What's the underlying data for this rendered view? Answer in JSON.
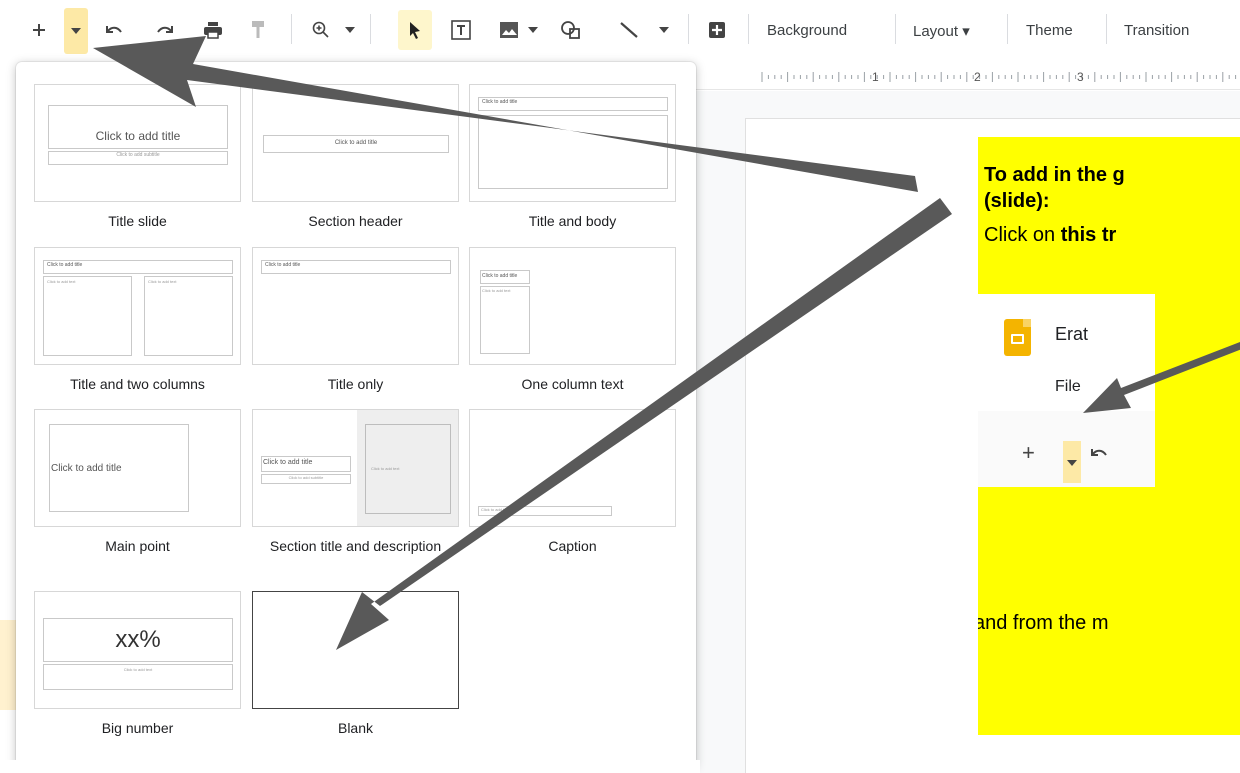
{
  "toolbar": {
    "icons": [
      "plus-icon",
      "chevron-down-icon",
      "undo-icon",
      "redo-icon",
      "print-icon",
      "paint-format-icon",
      "zoom-icon",
      "select-cursor-icon",
      "text-box-icon",
      "image-icon",
      "shape-icon",
      "line-icon",
      "comment-icon"
    ],
    "background_label": "Background",
    "layout_label": "Layout ▾",
    "theme_label": "Theme",
    "transition_label": "Transition"
  },
  "ruler": {
    "marks": [
      "1",
      "2",
      "3"
    ]
  },
  "layouts": [
    {
      "label": "Title slide",
      "title_text": "Click to add title",
      "subtitle_text": "Click to add subtitle"
    },
    {
      "label": "Section header",
      "title_text": "Click to add title"
    },
    {
      "label": "Title and body",
      "title_text": "Click to add title"
    },
    {
      "label": "Title and two columns",
      "title_text": "Click to add title",
      "col1_text": "Click to add text",
      "col2_text": "Click to add text"
    },
    {
      "label": "Title only",
      "title_text": "Click to add title"
    },
    {
      "label": "One column text",
      "title_text": "Click to add title",
      "body_text": "Click to add text"
    },
    {
      "label": "Main point",
      "title_text": "Click to add title"
    },
    {
      "label": "Section title and description",
      "title_text": "Click to add title",
      "subtitle_text": "Click to add subtitle",
      "side_text": "Click to add text"
    },
    {
      "label": "Caption",
      "caption_text": "Click to add text"
    },
    {
      "label": "Big number",
      "number_text": "xx%",
      "sub_text": "Click to add text"
    },
    {
      "label": "Blank"
    }
  ],
  "callout": {
    "title_line1": "To add in the g",
    "title_line2": "(slide):",
    "click_prefix": "Click on ",
    "click_bold": "this tr",
    "second_line": "and from the m",
    "inset": {
      "doc_name": "Erat",
      "menu_label": "File"
    }
  },
  "colors": {
    "callout_yellow": "#ffff00",
    "arrow_gray": "#595959",
    "caret_highlight": "#fde9a6",
    "slides_logo": "#f4b400"
  }
}
